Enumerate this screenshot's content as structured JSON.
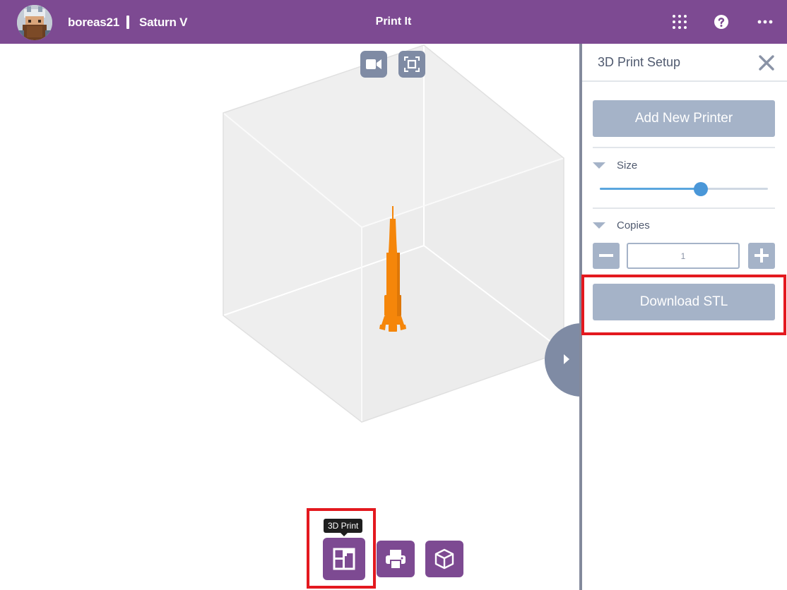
{
  "header": {
    "username": "boreas21",
    "project_name": "Saturn V",
    "title": "Print It",
    "icons": [
      "apps-grid-icon",
      "help-icon",
      "more-icon"
    ],
    "color": "#7d4a92"
  },
  "viewport": {
    "camera_button_icon": "video-camera-icon",
    "fit_button_icon": "fit-view-icon",
    "model_color": "#f5860a",
    "tooltip": "3D Print"
  },
  "toolbar": {
    "buttons": [
      {
        "name": "3D Print",
        "icon": "3d-print-icon",
        "active": true
      },
      {
        "name": "Print",
        "icon": "printer-icon"
      },
      {
        "name": "3D View",
        "icon": "cube-icon"
      }
    ]
  },
  "panel": {
    "title": "3D Print Setup",
    "add_printer_label": "Add New Printer",
    "size_label": "Size",
    "size_value": 0.6,
    "copies_label": "Copies",
    "copies_value": "1",
    "download_label": "Download STL",
    "accent": "#a5b3c8"
  }
}
